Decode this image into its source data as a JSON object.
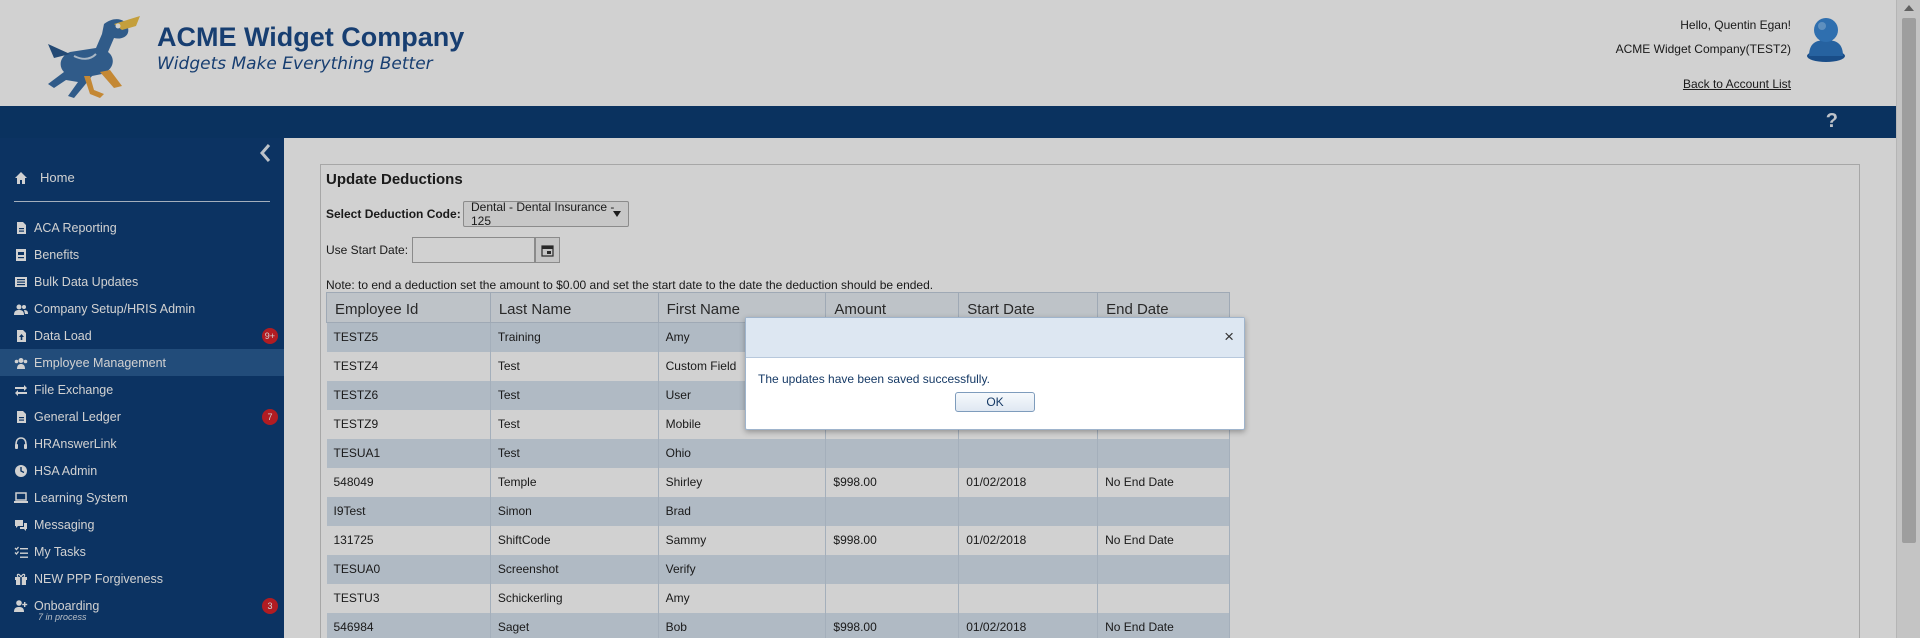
{
  "header": {
    "company_name": "ACME Widget Company",
    "tagline": "Widgets Make Everything Better",
    "greeting": "Hello, Quentin Egan!",
    "company_account": "ACME Widget Company(TEST2)",
    "back_link": "Back to Account List",
    "help": "?"
  },
  "sidebar": {
    "home": "Home",
    "items": [
      {
        "label": "ACA Reporting",
        "icon": "document-icon",
        "badge": ""
      },
      {
        "label": "Benefits",
        "icon": "benefits-icon",
        "badge": ""
      },
      {
        "label": "Bulk Data Updates",
        "icon": "list-icon",
        "badge": ""
      },
      {
        "label": "Company Setup/HRIS Admin",
        "icon": "users-icon",
        "badge": ""
      },
      {
        "label": "Data Load",
        "icon": "upload-icon",
        "badge": "9+"
      },
      {
        "label": "Employee Management",
        "icon": "users-icon",
        "badge": "",
        "active": true
      },
      {
        "label": "File Exchange",
        "icon": "exchange-icon",
        "badge": ""
      },
      {
        "label": "General Ledger",
        "icon": "document-icon",
        "badge": "7"
      },
      {
        "label": "HRAnswerLink",
        "icon": "headset-icon",
        "badge": ""
      },
      {
        "label": "HSA Admin",
        "icon": "clock-icon",
        "badge": ""
      },
      {
        "label": "Learning System",
        "icon": "laptop-icon",
        "badge": ""
      },
      {
        "label": "Messaging",
        "icon": "chat-icon",
        "badge": ""
      },
      {
        "label": "My Tasks",
        "icon": "tasks-icon",
        "badge": ""
      },
      {
        "label": "NEW PPP Forgiveness",
        "icon": "gift-icon",
        "badge": ""
      },
      {
        "label": "Onboarding",
        "icon": "add-user-icon",
        "badge": "3",
        "sub": "7 in process"
      }
    ]
  },
  "panel": {
    "title": "Update Deductions",
    "deduction_label": "Select Deduction Code:",
    "deduction_value": "Dental - Dental Insurance - 125",
    "start_label": "Use Start Date:",
    "start_value": "",
    "note": "Note: to end a deduction set the amount to $0.00 and set the start date to the date the deduction should be ended."
  },
  "table": {
    "columns": [
      "Employee Id",
      "Last Name",
      "First Name",
      "Amount",
      "Start Date",
      "End Date"
    ],
    "rows": [
      [
        "TESTZ5",
        "Training",
        "Amy",
        "",
        "",
        ""
      ],
      [
        "TESTZ4",
        "Test",
        "Custom Field",
        "",
        "",
        ""
      ],
      [
        "TESTZ6",
        "Test",
        "User",
        "",
        "",
        ""
      ],
      [
        "TESTZ9",
        "Test",
        "Mobile",
        "",
        "",
        ""
      ],
      [
        "TESUA1",
        "Test",
        "Ohio",
        "",
        "",
        ""
      ],
      [
        "548049",
        "Temple",
        "Shirley",
        "$998.00",
        "01/02/2018",
        "No End Date"
      ],
      [
        "I9Test",
        "Simon",
        "Brad",
        "",
        "",
        ""
      ],
      [
        "131725",
        "ShiftCode",
        "Sammy",
        "$998.00",
        "01/02/2018",
        "No End Date"
      ],
      [
        "TESUA0",
        "Screenshot",
        "Verify",
        "",
        "",
        ""
      ],
      [
        "TESTU3",
        "Schickerling",
        "Amy",
        "",
        "",
        ""
      ],
      [
        "546984",
        "Saget",
        "Bob",
        "$998.00",
        "01/02/2018",
        "No End Date"
      ]
    ]
  },
  "dialog": {
    "message": "The updates have been saved successfully.",
    "ok_label": "OK",
    "close": "×"
  }
}
